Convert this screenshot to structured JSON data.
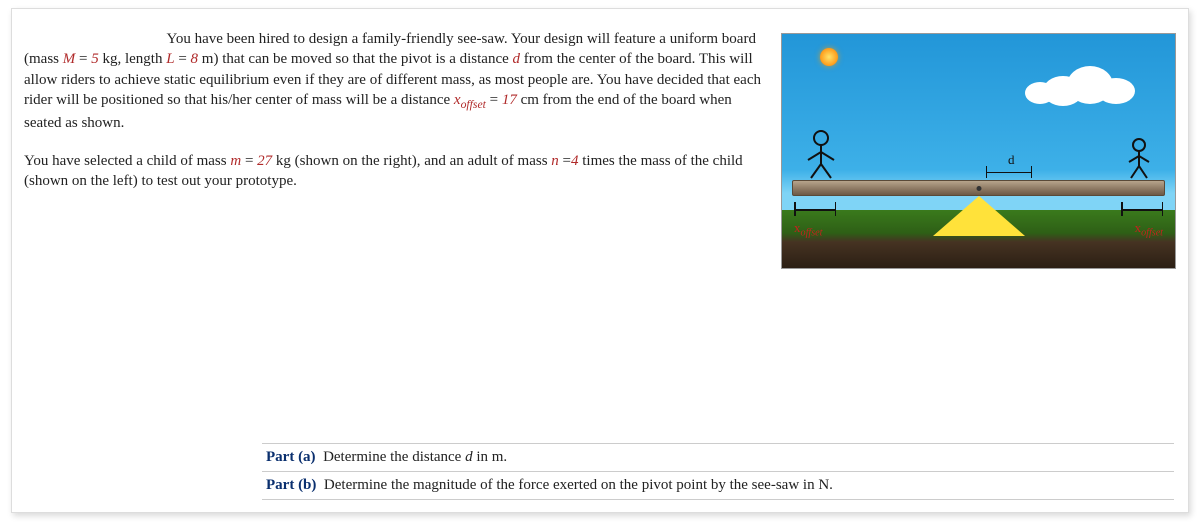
{
  "problem": {
    "intro": "You have been hired to design a family-friendly see-saw. Your design will feature a uniform board (mass ",
    "M_lbl": "M",
    "eq1": " = ",
    "M_val": "5",
    "M_unit": " kg, length ",
    "L_lbl": "L",
    "L_val": "8",
    "L_unit": " m) that can be moved so that the pivot is a distance ",
    "d_lbl": "d",
    "cont1": " from the center of the board. This will allow riders to achieve static equilibrium even if they are of different mass, as most people are. You have decided that each rider will be positioned so that his/her center of mass will be a distance ",
    "xoff_lbl": "x",
    "xoff_sub": "offset",
    "xoff_val": "17",
    "xoff_unit": " cm from the end of the board when seated as shown.",
    "para2_a": "You have selected a child of mass ",
    "m_lbl": "m",
    "m_val": "27",
    "m_unit": " kg (shown on the right), and an adult of mass ",
    "n_lbl": "n",
    "n_val": "4",
    "para2_b": " times the mass of the child (shown on the left) to test out your prototype."
  },
  "diagram": {
    "d_label": "d",
    "xoffset_label": "offset",
    "x_prefix": "x"
  },
  "parts": {
    "a_label": "Part (a)",
    "a_text": "Determine the distance ",
    "a_var": "d",
    "a_tail": " in m.",
    "b_label": "Part (b)",
    "b_text": "Determine the magnitude of the force exerted on the pivot point by the see-saw in N."
  }
}
